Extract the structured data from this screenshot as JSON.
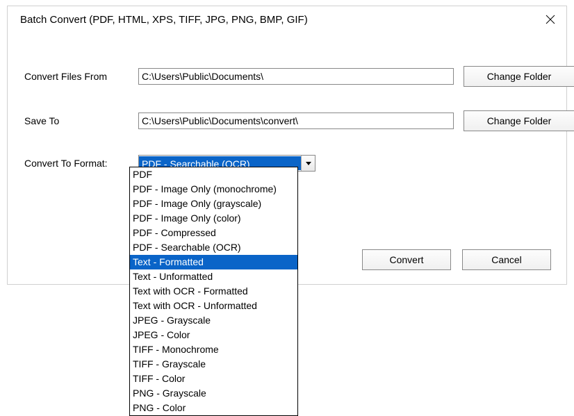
{
  "title": "Batch Convert (PDF, HTML, XPS, TIFF, JPG, PNG, BMP, GIF)",
  "labels": {
    "from": "Convert Files From",
    "saveTo": "Save To",
    "format": "Convert To Format:"
  },
  "inputs": {
    "from_value": "C:\\Users\\Public\\Documents\\",
    "saveTo_value": "C:\\Users\\Public\\Documents\\convert\\"
  },
  "buttons": {
    "changeFolder": "Change Folder",
    "convert": "Convert",
    "cancel": "Cancel"
  },
  "combo": {
    "selected": "PDF - Searchable (OCR)",
    "highlighted": "Text - Formatted",
    "options": [
      "PDF",
      "PDF - Image Only (monochrome)",
      "PDF - Image Only (grayscale)",
      "PDF - Image Only (color)",
      "PDF - Compressed",
      "PDF - Searchable (OCR)",
      "Text - Formatted",
      "Text - Unformatted",
      "Text with OCR - Formatted",
      "Text with OCR - Unformatted",
      "JPEG - Grayscale",
      "JPEG - Color",
      "TIFF - Monochrome",
      "TIFF - Grayscale",
      "TIFF - Color",
      "PNG - Grayscale",
      "PNG - Color"
    ]
  }
}
